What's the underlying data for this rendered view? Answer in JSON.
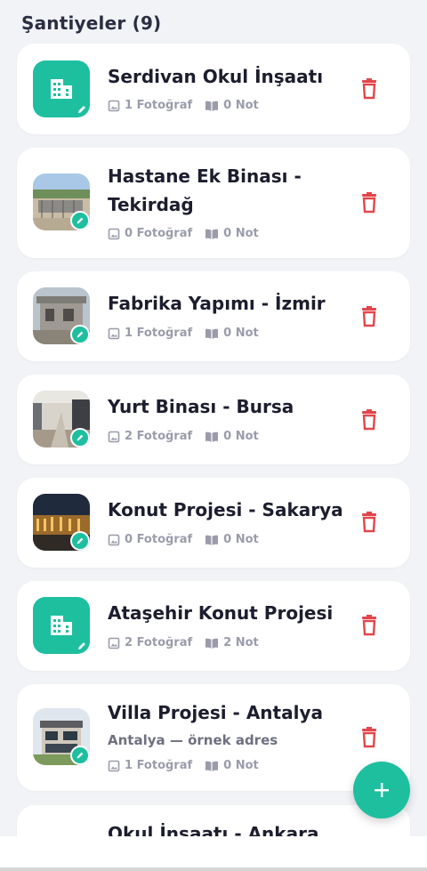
{
  "header": {
    "title": "Şantiyeler (9)"
  },
  "sites": [
    {
      "title": "Serdivan Okul İnşaatı",
      "photos": "1 Fotoğraf",
      "notes": "0 Not",
      "thumb": "building-icon"
    },
    {
      "title": "Hastane Ek Binası - Tekirdağ",
      "photos": "0 Fotoğraf",
      "notes": "0 Not",
      "thumb": "photo"
    },
    {
      "title": "Fabrika Yapımı - İzmir",
      "photos": "1 Fotoğraf",
      "notes": "0 Not",
      "thumb": "photo"
    },
    {
      "title": "Yurt Binası - Bursa",
      "photos": "2 Fotoğraf",
      "notes": "0 Not",
      "thumb": "photo"
    },
    {
      "title": "Konut Projesi - Sakarya",
      "photos": "0 Fotoğraf",
      "notes": "0 Not",
      "thumb": "photo"
    },
    {
      "title": "Ataşehir Konut Projesi",
      "photos": "2 Fotoğraf",
      "notes": "2 Not",
      "thumb": "building-icon"
    },
    {
      "title": "Villa Projesi - Antalya",
      "address": "Antalya — örnek adres",
      "photos": "1 Fotoğraf",
      "notes": "0 Not",
      "thumb": "photo"
    },
    {
      "title": "Okul İnşaatı - Ankara"
    }
  ],
  "colors": {
    "accent": "#1dbf9f",
    "danger": "#e2464a",
    "background": "#f2f3f7"
  },
  "icons": {
    "photo_count": "image-icon",
    "note_count": "book-icon",
    "delete": "trash-icon",
    "edit": "pencil-icon",
    "add": "plus-icon"
  }
}
